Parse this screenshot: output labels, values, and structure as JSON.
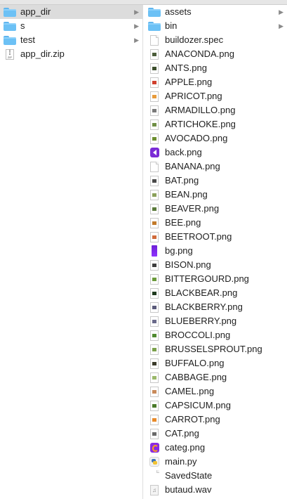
{
  "column1": {
    "items": [
      {
        "label": "app_dir",
        "kind": "folder",
        "selected": true,
        "has_children": true
      },
      {
        "label": "s",
        "kind": "folder",
        "selected": false,
        "has_children": true
      },
      {
        "label": "test",
        "kind": "folder",
        "selected": false,
        "has_children": true
      },
      {
        "label": "app_dir.zip",
        "kind": "zip",
        "selected": false,
        "has_children": false
      }
    ]
  },
  "column2": {
    "items": [
      {
        "label": "assets",
        "kind": "folder",
        "has_children": true
      },
      {
        "label": "bin",
        "kind": "folder",
        "has_children": true
      },
      {
        "label": "buildozer.spec",
        "kind": "plain"
      },
      {
        "label": "ANACONDA.png",
        "kind": "image",
        "thumb": "#4b5d3a"
      },
      {
        "label": "ANTS.png",
        "kind": "image",
        "thumb": "#3c4f2c"
      },
      {
        "label": "APPLE.png",
        "kind": "image",
        "thumb": "#d0402e"
      },
      {
        "label": "APRICOT.png",
        "kind": "image",
        "thumb": "#e79a3a"
      },
      {
        "label": "ARMADILLO.png",
        "kind": "image",
        "thumb": "#7a7a7a"
      },
      {
        "label": "ARTICHOKE.png",
        "kind": "image",
        "thumb": "#6f8f45"
      },
      {
        "label": "AVOCADO.png",
        "kind": "image",
        "thumb": "#6c8e2f"
      },
      {
        "label": "back.png",
        "kind": "back"
      },
      {
        "label": "BANANA.png",
        "kind": "plain"
      },
      {
        "label": "BAT.png",
        "kind": "image",
        "thumb": "#4a4a4a"
      },
      {
        "label": "BEAN.png",
        "kind": "image",
        "thumb": "#8aa05a"
      },
      {
        "label": "BEAVER.png",
        "kind": "image",
        "thumb": "#5a7a3a"
      },
      {
        "label": "BEE.png",
        "kind": "image",
        "thumb": "#c27a2a"
      },
      {
        "label": "BEETROOT.png",
        "kind": "image",
        "thumb": "#d06a3a"
      },
      {
        "label": "bg.png",
        "kind": "bg"
      },
      {
        "label": "BISON.png",
        "kind": "image",
        "thumb": "#3d3d3d"
      },
      {
        "label": "BITTERGOURD.png",
        "kind": "image",
        "thumb": "#6a9a3a"
      },
      {
        "label": "BLACKBEAR.png",
        "kind": "image",
        "thumb": "#1f3a1f"
      },
      {
        "label": "BLACKBERRY.png",
        "kind": "image",
        "thumb": "#5a5a7a"
      },
      {
        "label": "BLUEBERRY.png",
        "kind": "image",
        "thumb": "#6a6a8a"
      },
      {
        "label": "BROCCOLI.png",
        "kind": "image",
        "thumb": "#4f8a2f"
      },
      {
        "label": "BRUSSELSPROUT.png",
        "kind": "image",
        "thumb": "#7aa04a"
      },
      {
        "label": "BUFFALO.png",
        "kind": "image",
        "thumb": "#3a3a2a"
      },
      {
        "label": "CABBAGE.png",
        "kind": "image",
        "thumb": "#9ab86a"
      },
      {
        "label": "CAMEL.png",
        "kind": "image",
        "thumb": "#c98a5a"
      },
      {
        "label": "CAPSICUM.png",
        "kind": "image",
        "thumb": "#4a7a2a"
      },
      {
        "label": "CARROT.png",
        "kind": "image",
        "thumb": "#e88a2a"
      },
      {
        "label": "CAT.png",
        "kind": "image",
        "thumb": "#6a6a6a"
      },
      {
        "label": "categ.png",
        "kind": "categ"
      },
      {
        "label": "main.py",
        "kind": "python"
      },
      {
        "label": "SavedState",
        "kind": "folder-plain"
      },
      {
        "label": "butaud.wav",
        "kind": "sound"
      }
    ]
  },
  "icons": {
    "chevron": "▶",
    "note": "♫",
    "zip_text": "ZIP"
  }
}
